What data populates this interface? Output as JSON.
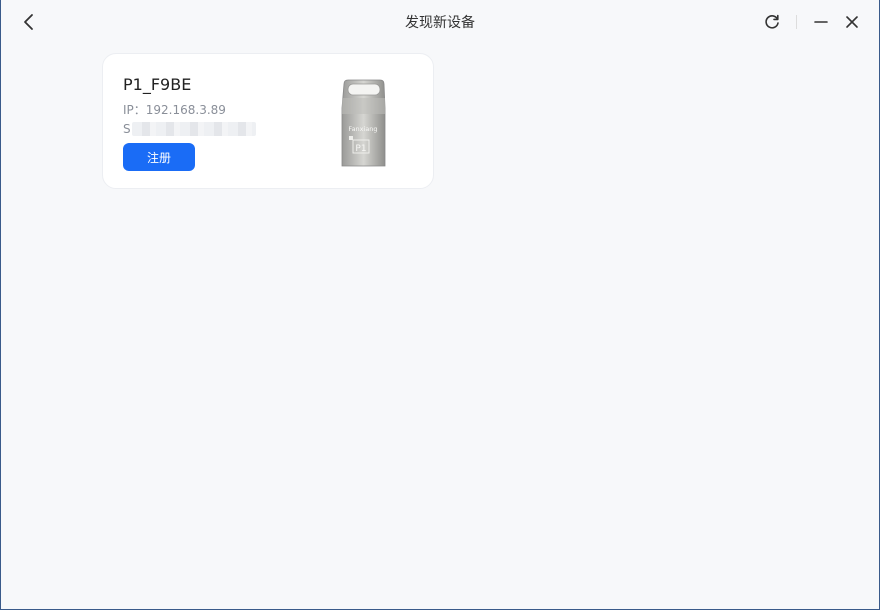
{
  "window": {
    "title": "发现新设备"
  },
  "device_card": {
    "name": "P1_F9BE",
    "ip_label": "IP：192.168.3.89",
    "sn_prefix": "S",
    "register_label": "注册",
    "image_brand": "Fanxiang",
    "image_model": "P1"
  },
  "colors": {
    "accent": "#1a6cf6",
    "background": "#f7f8fa",
    "card": "#ffffff"
  },
  "icons": {
    "back": "chevron-left-icon",
    "refresh": "refresh-icon",
    "minimize": "minimize-icon",
    "close": "close-icon"
  }
}
